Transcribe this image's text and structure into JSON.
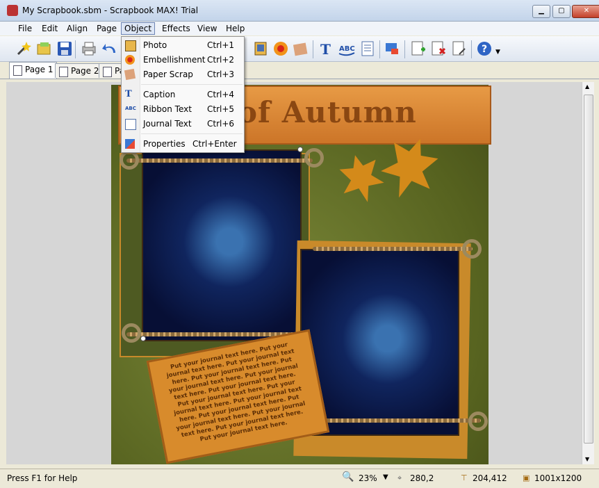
{
  "window": {
    "title": "My Scrapbook.sbm - Scrapbook MAX! Trial"
  },
  "menu": [
    "File",
    "Edit",
    "Align",
    "Page",
    "Object",
    "Effects",
    "View",
    "Help"
  ],
  "tabs": [
    "Page 1",
    "Page 2",
    "Pa"
  ],
  "object_menu": {
    "items": [
      {
        "label": "Photo",
        "shortcut": "Ctrl+1",
        "icon": "photo-icon"
      },
      {
        "label": "Embellishment",
        "shortcut": "Ctrl+2",
        "icon": "embellishment-icon"
      },
      {
        "label": "Paper Scrap",
        "shortcut": "Ctrl+3",
        "icon": "paper-scrap-icon"
      },
      {
        "label": "Caption",
        "shortcut": "Ctrl+4",
        "icon": "caption-icon"
      },
      {
        "label": "Ribbon Text",
        "shortcut": "Ctrl+5",
        "icon": "ribbon-text-icon"
      },
      {
        "label": "Journal Text",
        "shortcut": "Ctrl+6",
        "icon": "journal-text-icon"
      },
      {
        "label": "Properties",
        "shortcut": "Ctrl+Enter",
        "icon": "properties-icon"
      }
    ]
  },
  "canvas": {
    "banner_text": "of Autumn",
    "journal_text": "Put your journal text here. Put your journal text here. Put your journal text here. Put your journal text here. Put your journal text here. Put your journal text here. Put your journal text here. Put your journal text here. Put your journal text here. Put your journal text here. Put your journal text here. Put your journal text here. Put your journal text here. Put your journal text here. Put your journal text here."
  },
  "status": {
    "help": "Press F1 for Help",
    "zoom": "23%",
    "cursor": "280,2",
    "position": "204,412",
    "size": "1001x1200"
  },
  "colors": {
    "menu_highlight": "#dde6f5",
    "banner": "#d9852f",
    "background_paper": "#6b7a2e"
  }
}
